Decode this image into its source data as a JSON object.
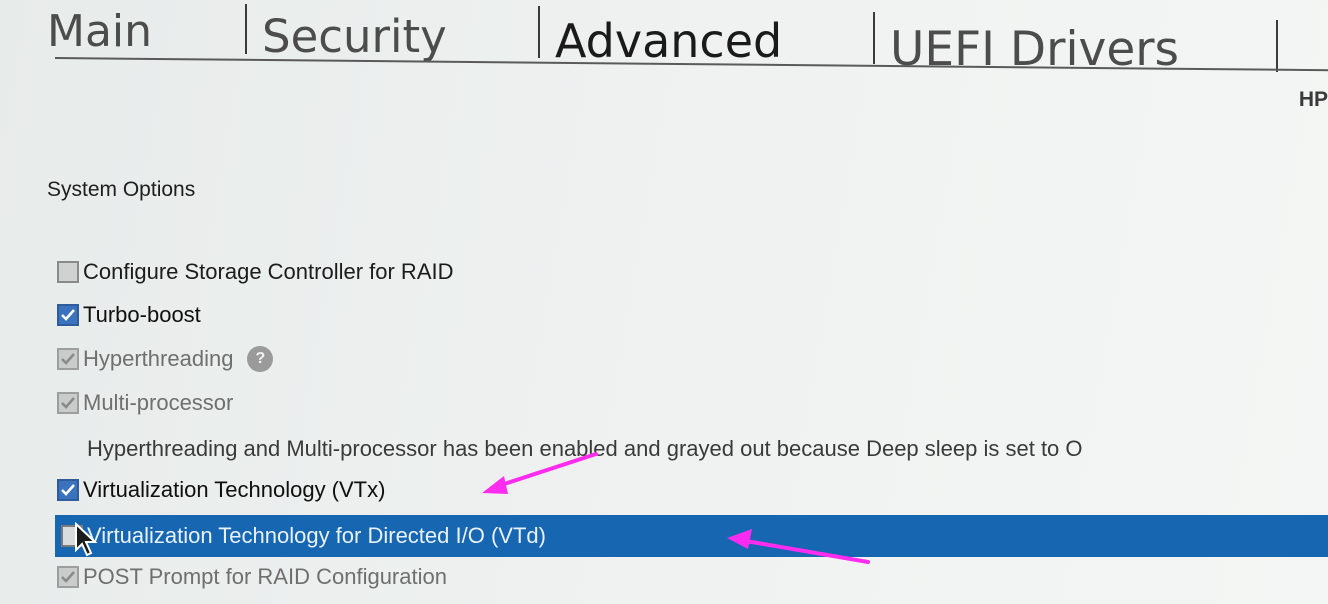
{
  "tabs": [
    {
      "label": "Main",
      "active": false
    },
    {
      "label": "Security",
      "active": false
    },
    {
      "label": "Advanced",
      "active": true
    },
    {
      "label": "UEFI Drivers",
      "active": false
    }
  ],
  "brand": "HP",
  "section_title": "System Options",
  "options": [
    {
      "label": "Configure Storage Controller for RAID",
      "checked": false,
      "enabled": true
    },
    {
      "label": "Turbo-boost",
      "checked": true,
      "enabled": true
    },
    {
      "label": "Hyperthreading",
      "checked": true,
      "enabled": false,
      "help_icon": "question-circle-icon"
    },
    {
      "label": "Multi-processor",
      "checked": true,
      "enabled": false
    },
    {
      "label": "Virtualization Technology (VTx)",
      "checked": true,
      "enabled": true
    },
    {
      "label": "Virtualization Technology for Directed I/O (VTd)",
      "checked": false,
      "enabled": true,
      "selected": true
    },
    {
      "label": "POST Prompt for RAID Configuration",
      "checked": true,
      "enabled": false
    }
  ],
  "note": "Hyperthreading and Multi-processor has been enabled and grayed out because Deep sleep is set to O",
  "help_glyph": "?",
  "colors": {
    "selection": "#1666b2",
    "checkbox_checked": "#3a72bd",
    "annotation_arrow": "#ff2cf0"
  },
  "icons": {
    "cursor": "mouse-pointer-icon",
    "annotation": "magenta-arrow-icon"
  }
}
